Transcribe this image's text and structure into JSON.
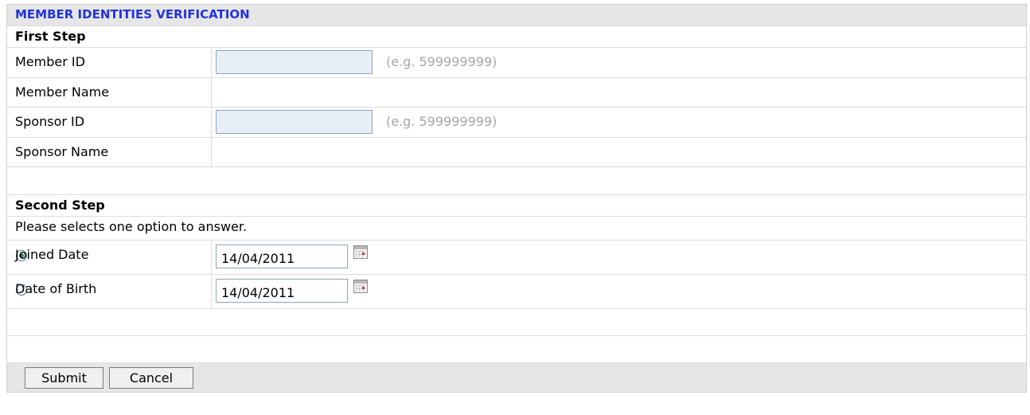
{
  "title": "MEMBER IDENTITIES VERIFICATION",
  "first_step": {
    "heading": "First Step",
    "member_id": {
      "label": "Member ID",
      "value": "",
      "hint": "(e.g. 599999999)"
    },
    "member_name": {
      "label": "Member Name",
      "value": ""
    },
    "sponsor_id": {
      "label": "Sponsor ID",
      "value": "",
      "hint": "(e.g. 599999999)"
    },
    "sponsor_name": {
      "label": "Sponsor Name",
      "value": ""
    }
  },
  "second_step": {
    "heading": "Second Step",
    "instruction": "Please selects one option to answer.",
    "options": [
      {
        "label": "Joined Date",
        "value": "14/04/2011",
        "selected": true,
        "icon": "calendar-icon"
      },
      {
        "label": "Date of Birth",
        "value": "14/04/2011",
        "selected": false,
        "icon": "calendar-icon"
      }
    ]
  },
  "buttons": {
    "submit": "Submit",
    "cancel": "Cancel"
  },
  "colors": {
    "title_text": "#2233dd",
    "header_bg": "#e6e6e6",
    "input_bg": "#e6eef6",
    "hint_text": "#a6a6a6"
  }
}
